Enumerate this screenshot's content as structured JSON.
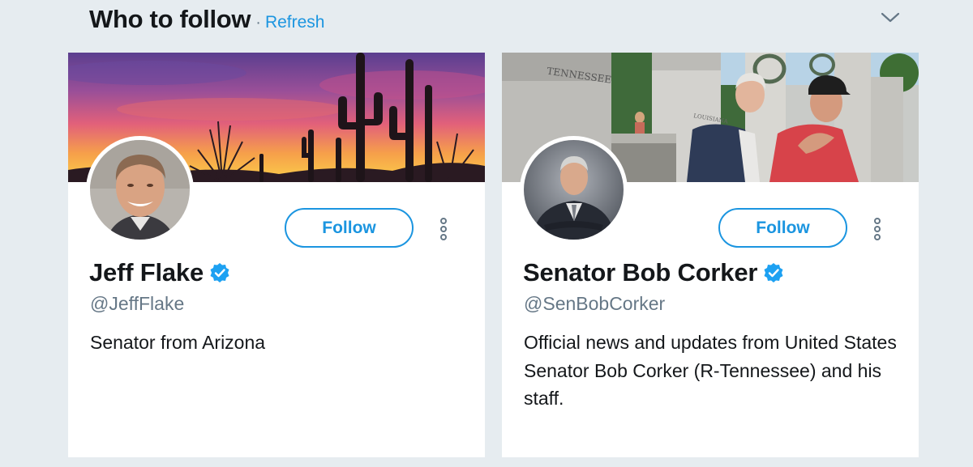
{
  "header": {
    "title": "Who to follow",
    "separator": "·",
    "refresh_label": "Refresh"
  },
  "cards": [
    {
      "name": "Jeff Flake",
      "handle": "@JeffFlake",
      "bio": "Senator from Arizona",
      "follow_label": "Follow",
      "verified": true,
      "banner": "sunset-saguaro-cactus"
    },
    {
      "name": "Senator Bob Corker",
      "handle": "@SenBobCorker",
      "bio": "Official news and updates from United States Senator Bob Corker (R-Tennessee) and his staff.",
      "follow_label": "Follow",
      "verified": true,
      "banner": "memorial-visit-photo",
      "banner_texts": [
        "TENNESSEE",
        "LOUISIANA"
      ]
    }
  ],
  "colors": {
    "accent": "#1b95e0",
    "background": "#e6ecf0",
    "text_primary": "#14171a",
    "text_secondary": "#657786"
  },
  "icons": [
    "chevron-down-icon",
    "verified-badge-icon",
    "more-options-icon"
  ]
}
